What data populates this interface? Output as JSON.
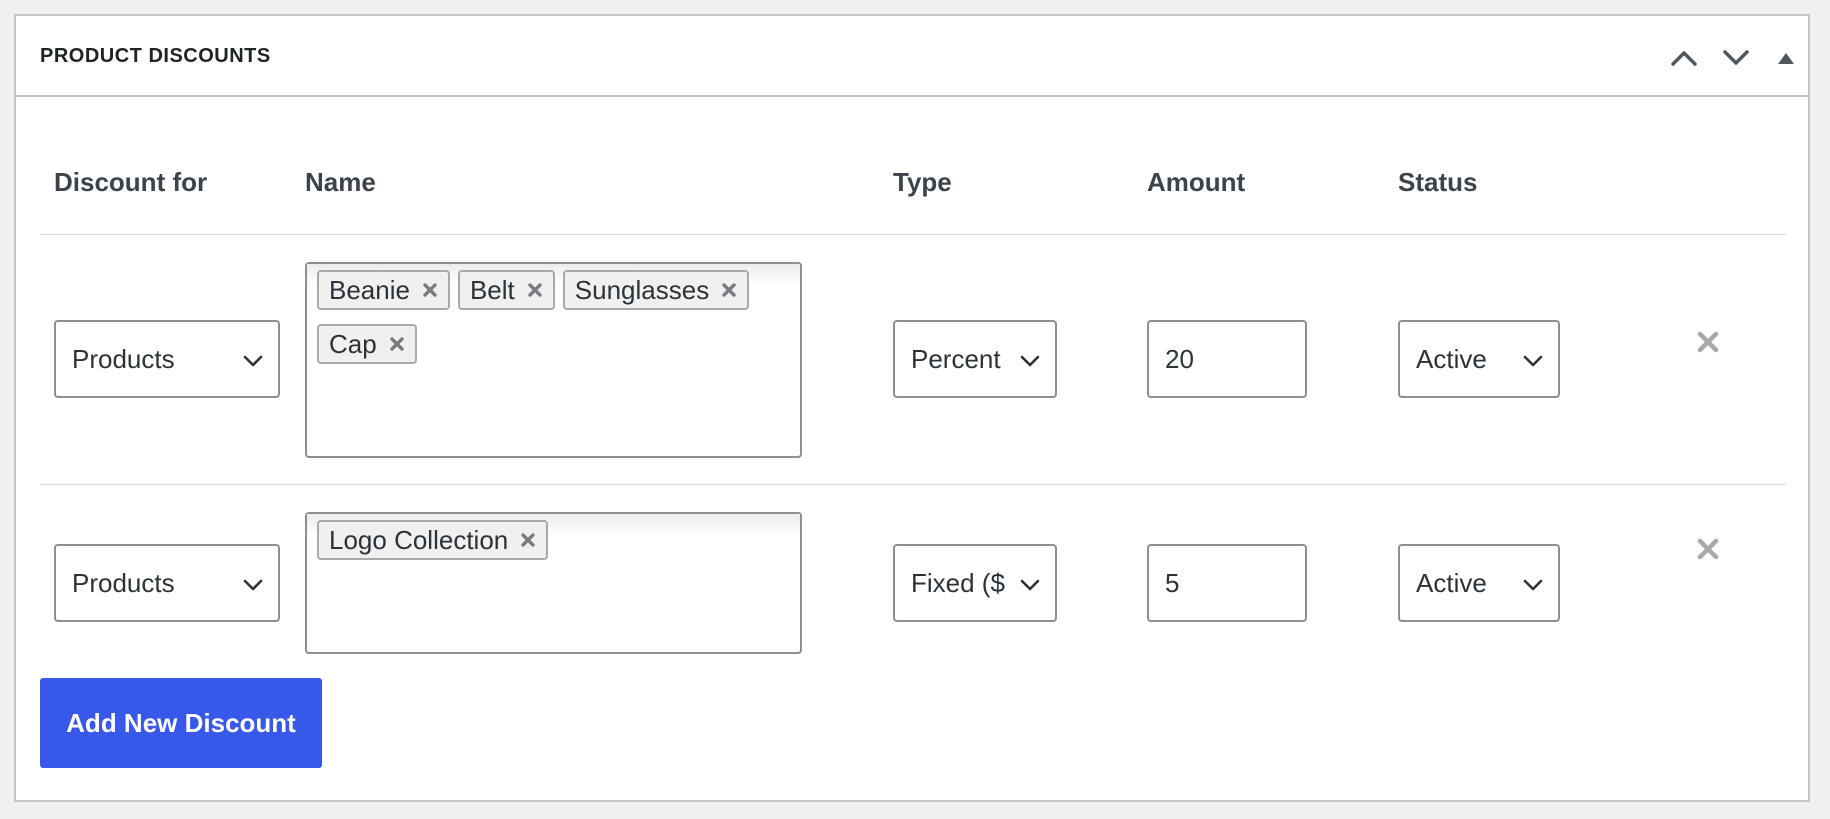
{
  "panel": {
    "title": "PRODUCT DISCOUNTS",
    "move_up_icon": "chevron-up-icon",
    "move_down_icon": "chevron-down-icon",
    "toggle_icon": "triangle-up-icon"
  },
  "table": {
    "headers": {
      "discount_for": "Discount for",
      "name": "Name",
      "type": "Type",
      "amount": "Amount",
      "status": "Status"
    },
    "rows": [
      {
        "discount_for": "Products",
        "names": [
          "Beanie",
          "Belt",
          "Sunglasses",
          "Cap"
        ],
        "type": "Percent",
        "amount": "20",
        "status": "Active",
        "remove_icon": "close-icon"
      },
      {
        "discount_for": "Products",
        "names": [
          "Logo Collection"
        ],
        "type": "Fixed ($",
        "amount": "5",
        "status": "Active",
        "remove_icon": "close-icon"
      }
    ]
  },
  "add_button_label": "Add New Discount",
  "colors": {
    "accent": "#3858e9",
    "border": "#8c8f94",
    "panel_border": "#c3c4c7",
    "background": "#f0f0f1"
  }
}
